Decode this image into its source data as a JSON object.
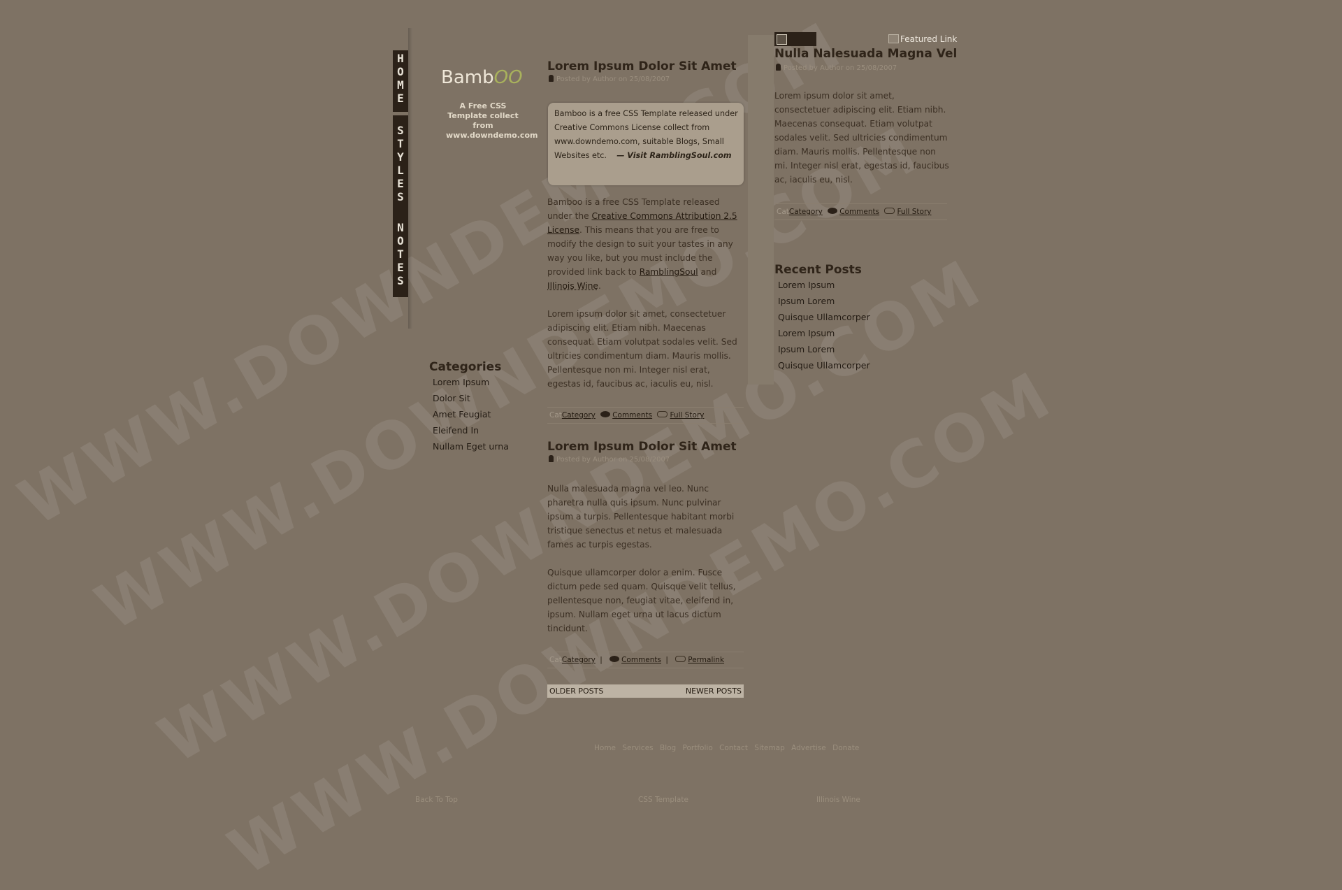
{
  "nav": {
    "home": "HOME",
    "styles": "STYLES",
    "notes": "NOTES"
  },
  "logo": {
    "main": "Bamb",
    "accent": "OO"
  },
  "tagline": [
    "A Free CSS",
    "Template collect",
    "from",
    "www.downdemo.com"
  ],
  "categories": {
    "title": "Categories",
    "items": [
      "Lorem Ipsum",
      "Dolor Sit",
      "Amet Feugiat",
      "Eleifend In",
      "Nullam Eget urna"
    ]
  },
  "post1": {
    "title": "Lorem Ipsum Dolor Sit Amet",
    "meta": "Posted by Author on 25/08/2007",
    "quote": "Bamboo is a free CSS Template released under Creative Commons License collect from www.downdemo.com, suitable Blogs, Small Websites etc.",
    "quote_link": "— Visit RamblingSoul.com",
    "p1": {
      "a": "Bamboo is a free CSS Template released under the ",
      "link1": "Creative Commons Attribution 2.5 License",
      "b": ". This means that you are free to modify the design to suit your tastes in any way you like, but you must include the provided link back to ",
      "link2": "RamblingSoul",
      "c": " and ",
      "link3": "Illinois Wine",
      "d": "."
    },
    "p2": "Lorem ipsum dolor sit amet, consectetuer adipiscing elit. Etiam nibh. Maecenas consequat. Etiam volutpat sodales velit. Sed ultricies condimentum diam. Mauris mollis. Pellentesque non mi. Integer nisl erat, egestas id, faucibus ac, iaculis eu, nisl.",
    "footer": {
      "cat_alt": "Cat",
      "category": "Category",
      "comments": "Comments",
      "full": "Full Story"
    }
  },
  "post2": {
    "title": "Lorem Ipsum Dolor Sit Amet",
    "meta": "Posted by Author on 25/08/2007",
    "p1": "Nulla malesuada magna vel leo. Nunc pharetra nulla quis ipsum. Nunc pulvinar ipsum a turpis. Pellentesque habitant morbi tristique senectus et netus et malesuada fames ac turpis egestas.",
    "p2": "Quisque ullamcorper dolor a enim. Fusce dictum pede sed quam. Quisque velit tellus, pellentesque non, feugiat vitae, eleifend in, ipsum. Nullam eget urna ut lacus dictum tincidunt.",
    "footer": {
      "cat_alt": "Cat",
      "category": "Category",
      "comments": "Comments",
      "permalink": "Permalink",
      "sep": "|"
    }
  },
  "pager": {
    "older": "OLDER POSTS",
    "newer": "NEWER POSTS"
  },
  "featured": {
    "link": "Featured Link",
    "title": "Nulla Nalesuada Magna Vel",
    "meta": "Posted by Author on 25/08/2007",
    "text": "Lorem ipsum dolor sit amet, consectetuer adipiscing elit. Etiam nibh. Maecenas consequat. Etiam volutpat sodales velit. Sed ultricies condimentum diam. Mauris mollis. Pellentesque non mi. Integer nisl erat, egestas id, faucibus ac, iaculis eu, nisl.",
    "footer": {
      "cat_alt": "Cat",
      "category": "Category",
      "comments": "Comments",
      "full": "Full Story"
    }
  },
  "recent": {
    "title": "Recent Posts",
    "items": [
      "Lorem Ipsum",
      "Ipsum Lorem",
      "Quisque Ullamcorper",
      "Lorem Ipsum",
      "Ipsum Lorem",
      "Quisque Ullamcorper"
    ]
  },
  "footer_links": [
    "Home",
    "Services",
    "Blog",
    "Portfolio",
    "Contact",
    "Sitemap",
    "Advertise",
    "Donate"
  ],
  "bottom": {
    "back": "Back To Top",
    "css": "CSS Template",
    "wine": "Illinois Wine"
  },
  "watermark": "WWW.DOWNDEMO.COM"
}
